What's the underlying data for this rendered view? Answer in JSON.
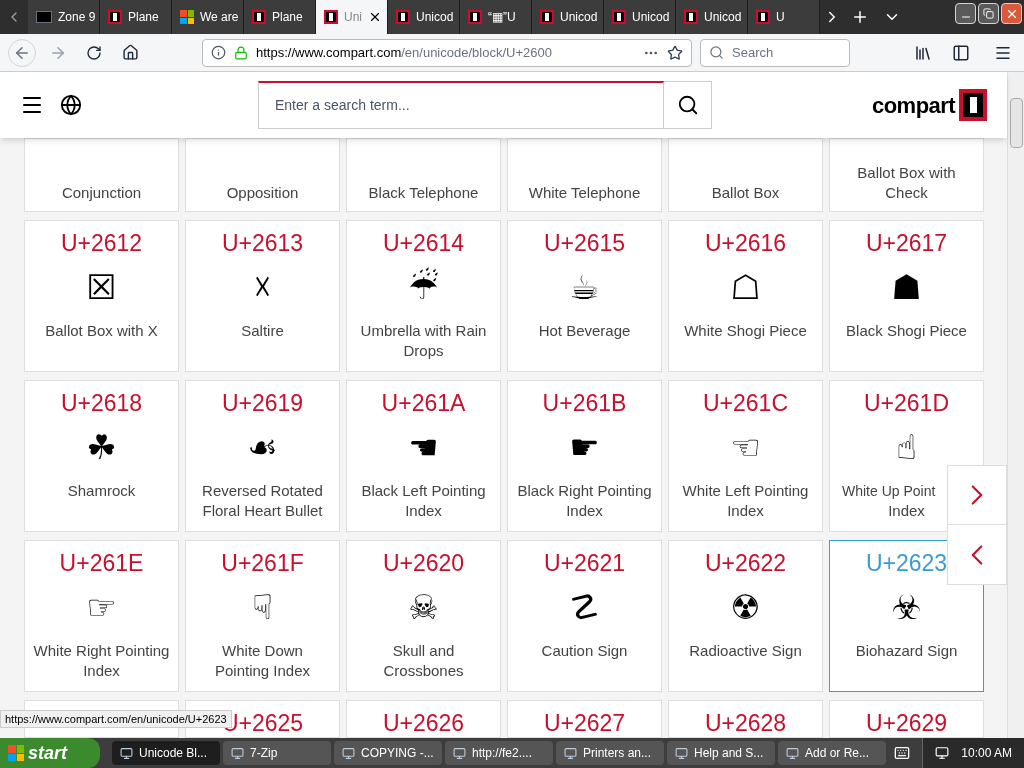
{
  "tabs": [
    {
      "label": "Zone 9",
      "kind": "dark",
      "selected": false
    },
    {
      "label": "Plane",
      "kind": "compart",
      "selected": false
    },
    {
      "label": "We are",
      "kind": "windows",
      "selected": false
    },
    {
      "label": "Plane",
      "kind": "compart",
      "selected": false
    },
    {
      "label": "Uni",
      "kind": "compart",
      "selected": true
    },
    {
      "label": "Unicod",
      "kind": "compart",
      "selected": false
    },
    {
      "label": "“▦”U",
      "kind": "compart",
      "selected": false
    },
    {
      "label": "Unicod",
      "kind": "compart",
      "selected": false
    },
    {
      "label": "Unicod",
      "kind": "compart",
      "selected": false
    },
    {
      "label": "Unicod",
      "kind": "compart",
      "selected": false
    },
    {
      "label": "U",
      "kind": "compart",
      "selected": false
    }
  ],
  "address": {
    "host": "https://www.compart.com",
    "path": "/en/unicode/block/U+2600"
  },
  "browser_search": {
    "placeholder": "Search"
  },
  "site": {
    "search_placeholder": "Enter a search term...",
    "logo": "compart"
  },
  "rows": [
    [
      {
        "name": "Conjunction",
        "selected": false
      },
      {
        "name": "Opposition",
        "selected": false
      },
      {
        "name": "Black Telephone",
        "selected": false
      },
      {
        "name": "White Telephone",
        "selected": false
      },
      {
        "name": "Ballot Box",
        "selected": false
      },
      {
        "name": "Ballot Box with Check",
        "selected": false
      }
    ],
    [
      {
        "code": "U+2612",
        "glyph": "☒",
        "name": "Ballot Box with X",
        "selected": false
      },
      {
        "code": "U+2613",
        "glyph": "☓",
        "name": "Saltire",
        "selected": false
      },
      {
        "code": "U+2614",
        "glyph": "☔",
        "name": "Umbrella with Rain Drops",
        "selected": false
      },
      {
        "code": "U+2615",
        "glyph": "☕",
        "name": "Hot Beverage",
        "selected": false
      },
      {
        "code": "U+2616",
        "glyph": "☖",
        "name": "White Shogi Piece",
        "selected": false
      },
      {
        "code": "U+2617",
        "glyph": "☗",
        "name": "Black Shogi Piece",
        "selected": false
      }
    ],
    [
      {
        "code": "U+2618",
        "glyph": "☘",
        "name": "Shamrock",
        "selected": false
      },
      {
        "code": "U+2619",
        "glyph": "☙",
        "name": "Reversed Rotated Floral Heart Bullet",
        "selected": false
      },
      {
        "code": "U+261A",
        "glyph": "☚",
        "name": "Black Left Pointing Index",
        "selected": false
      },
      {
        "code": "U+261B",
        "glyph": "☛",
        "name": "Black Right Pointing Index",
        "selected": false
      },
      {
        "code": "U+261C",
        "glyph": "☜",
        "name": "White Left Pointing Index",
        "selected": false
      },
      {
        "code": "U+261D",
        "glyph": "☝",
        "name": "White Up Point",
        "name2": "Index",
        "selected": false
      }
    ],
    [
      {
        "code": "U+261E",
        "glyph": "☞",
        "name": "White Right Pointing Index",
        "selected": false
      },
      {
        "code": "U+261F",
        "glyph": "☟",
        "name": "White Down Pointing Index",
        "selected": false
      },
      {
        "code": "U+2620",
        "glyph": "☠",
        "name": "Skull and Crossbones",
        "selected": false
      },
      {
        "code": "U+2621",
        "glyph": "☡",
        "name": "Caution Sign",
        "selected": false
      },
      {
        "code": "U+2622",
        "glyph": "☢",
        "name": "Radioactive Sign",
        "selected": false
      },
      {
        "code": "U+2623",
        "glyph": "☣",
        "name": "Biohazard Sign",
        "selected": true
      }
    ],
    [
      {
        "selected": false
      },
      {
        "code": "U+2625",
        "selected": false
      },
      {
        "code": "U+2626",
        "selected": false
      },
      {
        "code": "U+2627",
        "selected": false
      },
      {
        "code": "U+2628",
        "selected": false
      },
      {
        "code": "U+2629",
        "selected": false
      }
    ]
  ],
  "status_url": "https://www.compart.com/en/unicode/U+2623",
  "taskbar": {
    "start": "start",
    "items": [
      {
        "label": "Unicode Bl...",
        "selected": true
      },
      {
        "label": "7-Zip",
        "selected": false
      },
      {
        "label": "COPYING -...",
        "selected": false
      },
      {
        "label": "http://fe2....",
        "selected": false
      },
      {
        "label": "Printers an...",
        "selected": false
      },
      {
        "label": "Help and S...",
        "selected": false
      },
      {
        "label": "Add or Re...",
        "selected": false
      }
    ],
    "clock": "10:00 AM"
  }
}
